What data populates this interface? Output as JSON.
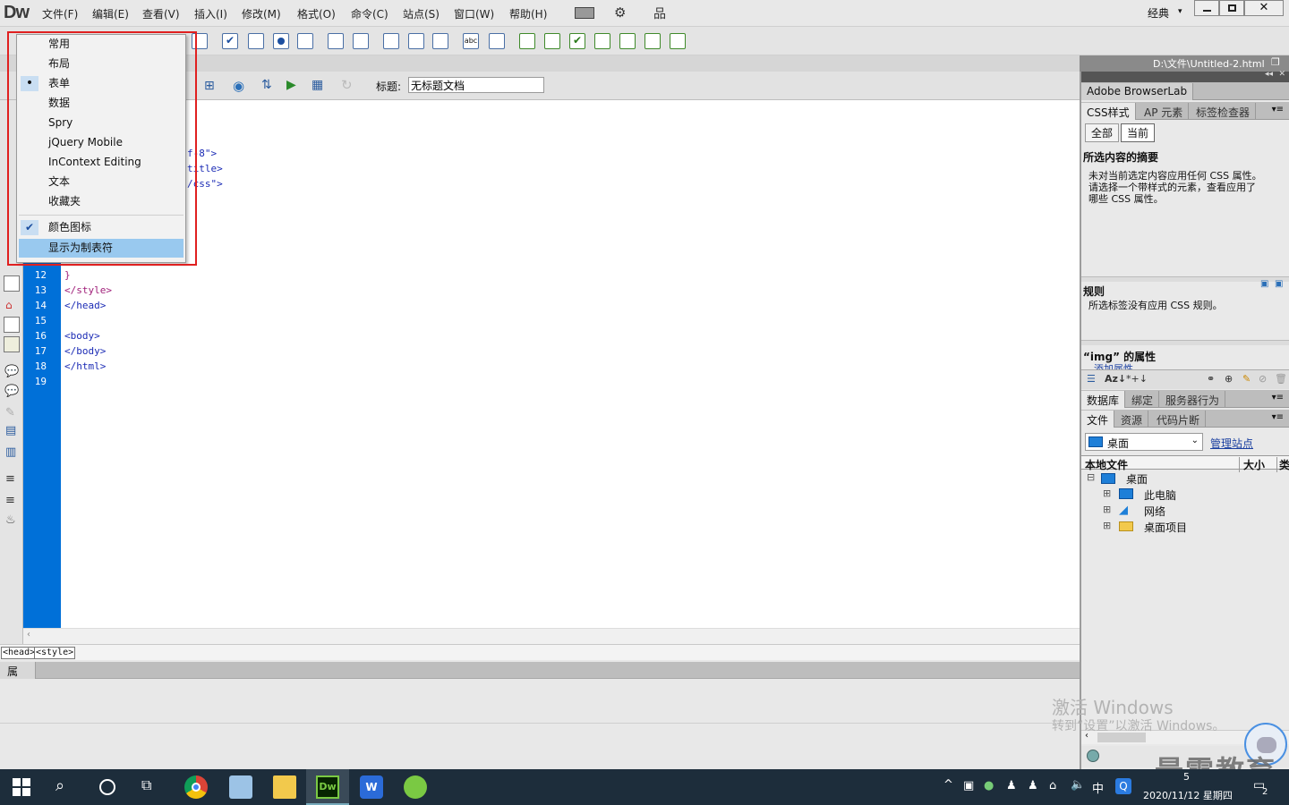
{
  "app": {
    "logo": "Dw",
    "workspace": "经典"
  },
  "menu": [
    "文件(F)",
    "编辑(E)",
    "查看(V)",
    "插入(I)",
    "修改(M)",
    "格式(O)",
    "命令(C)",
    "站点(S)",
    "窗口(W)",
    "帮助(H)"
  ],
  "document": {
    "path": "D:\\文件\\Untitled-2.html",
    "title_label": "标题:",
    "title_value": "无标题文档"
  },
  "code": {
    "line_numbers": [
      "12",
      "13",
      "14",
      "15",
      "16",
      "17",
      "18",
      "19"
    ],
    "partial_lines": [
      "f-8\">",
      "title>",
      "/css\">"
    ],
    "lines": [
      "}",
      "</style>",
      "</head>",
      "",
      "<body>",
      "</body>",
      "</html>",
      ""
    ]
  },
  "tag_selector": [
    "<head>",
    "<style>"
  ],
  "properties": {
    "tab": "属性"
  },
  "popup_menu": {
    "items": [
      {
        "label": "常用",
        "mark": ""
      },
      {
        "label": "布局",
        "mark": ""
      },
      {
        "label": "表单",
        "mark": "•"
      },
      {
        "label": "数据",
        "mark": ""
      },
      {
        "label": "Spry",
        "mark": ""
      },
      {
        "label": "jQuery Mobile",
        "mark": ""
      },
      {
        "label": "InContext Editing",
        "mark": ""
      },
      {
        "label": "文本",
        "mark": ""
      },
      {
        "label": "收藏夹",
        "mark": ""
      }
    ],
    "options": [
      {
        "label": "颜色图标",
        "mark": "✔"
      },
      {
        "label": "显示为制表符",
        "mark": ""
      }
    ]
  },
  "right_panel": {
    "browserlab": "Adobe BrowserLab",
    "css_tabs": [
      "CSS样式",
      "AP 元素",
      "标签检查器"
    ],
    "mode_buttons": [
      "全部",
      "当前"
    ],
    "summary_title": "所选内容的摘要",
    "summary_text": [
      "未对当前选定内容应用任何 CSS 属性。",
      "请选择一个带样式的元素，查看应用了",
      "哪些 CSS 属性。"
    ],
    "rules_title": "规则",
    "rules_text": "所选标签没有应用 CSS 规则。",
    "props_title": "“img” 的属性",
    "props_add": "添加属性",
    "db_tabs": [
      "数据库",
      "绑定",
      "服务器行为"
    ],
    "file_tabs": [
      "文件",
      "资源",
      "代码片断"
    ],
    "site_select": "桌面",
    "manage_sites": "管理站点",
    "file_cols": [
      "本地文件",
      "大小",
      "类型"
    ],
    "tree": [
      {
        "label": "桌面",
        "toggle": "⊟"
      },
      {
        "label": "此电脑",
        "toggle": "⊞"
      },
      {
        "label": "网络",
        "toggle": "⊞"
      },
      {
        "label": "桌面项目",
        "toggle": "⊞"
      }
    ]
  },
  "activation": {
    "line1": "激活 Windows",
    "line2": "转到“设置”以激活 Windows。"
  },
  "brand": "最需教育",
  "taskbar": {
    "date": "2020/11/12 星期四",
    "ime": "中",
    "notif": "2",
    "time_partial": "5"
  }
}
